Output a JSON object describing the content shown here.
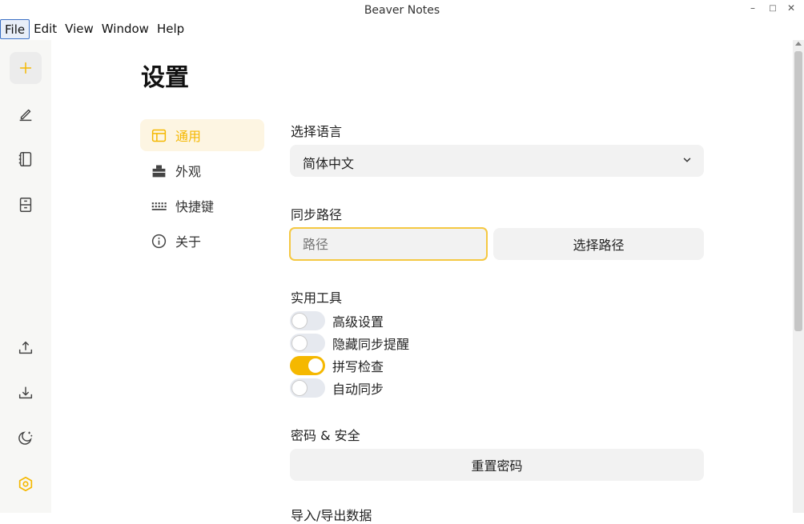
{
  "window": {
    "title": "Beaver Notes",
    "controls": {
      "minimize": "–",
      "maximize": "□",
      "close": "✕"
    }
  },
  "menubar": {
    "items": [
      "File",
      "Edit",
      "View",
      "Window",
      "Help"
    ]
  },
  "sidebar": {
    "top": [
      "add-note",
      "edit-note",
      "notebook",
      "archive"
    ],
    "bottom": [
      "upload",
      "download",
      "dark-mode",
      "settings"
    ]
  },
  "settings": {
    "title": "设置",
    "nav": [
      {
        "label": "通用",
        "icon": "window-icon",
        "active": true
      },
      {
        "label": "外观",
        "icon": "appearance-icon",
        "active": false
      },
      {
        "label": "快捷键",
        "icon": "keyboard-icon",
        "active": false
      },
      {
        "label": "关于",
        "icon": "info-icon",
        "active": false
      }
    ],
    "language": {
      "label": "选择语言",
      "value": "简体中文"
    },
    "sync": {
      "label": "同步路径",
      "placeholder": "路径",
      "button": "选择路径"
    },
    "utilities": {
      "label": "实用工具",
      "toggles": [
        {
          "label": "高级设置",
          "on": false
        },
        {
          "label": "隐藏同步提醒",
          "on": false
        },
        {
          "label": "拼写检查",
          "on": true
        },
        {
          "label": "自动同步",
          "on": false
        }
      ]
    },
    "security": {
      "label": "密码 & 安全",
      "button": "重置密码"
    },
    "import_export": {
      "label": "导入/导出数据"
    }
  },
  "colors": {
    "accent": "#f5b800",
    "accent_bg": "#fdf5e2",
    "field_bg": "#f2f2f2",
    "sidebar_bg": "#f7f7f5"
  }
}
